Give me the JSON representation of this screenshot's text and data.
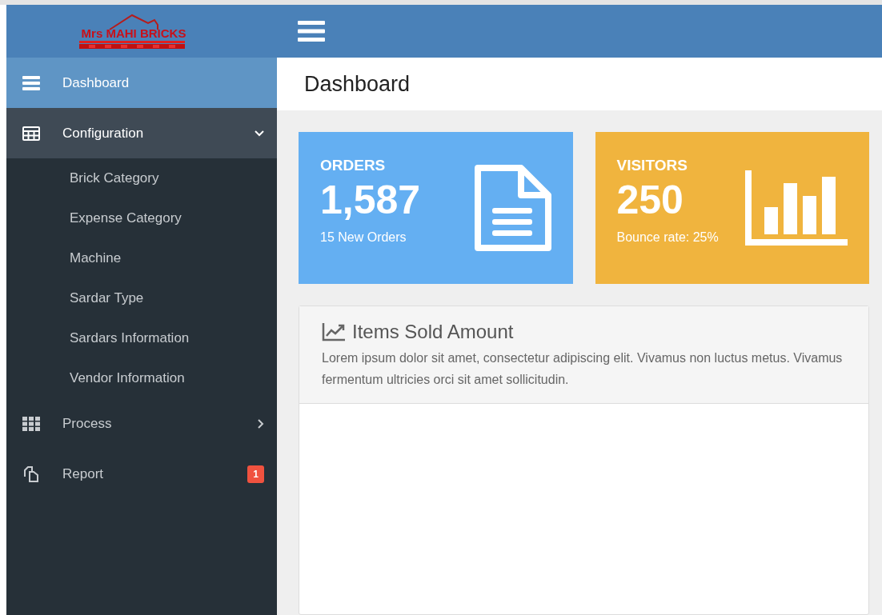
{
  "logo": {
    "text": "Mrs MAHI BRICKS"
  },
  "sidebar": {
    "items": [
      {
        "label": "Dashboard",
        "selected": true
      },
      {
        "label": "Configuration",
        "selected": false,
        "expanded": true,
        "children": [
          {
            "label": "Brick Category"
          },
          {
            "label": "Expense Category"
          },
          {
            "label": "Machine"
          },
          {
            "label": "Sardar Type"
          },
          {
            "label": "Sardars Information"
          },
          {
            "label": "Vendor Information"
          }
        ]
      },
      {
        "label": "Process",
        "selected": false,
        "expanded": false
      },
      {
        "label": "Report",
        "selected": false,
        "badge": "1"
      }
    ]
  },
  "page_title": "Dashboard",
  "stat_cards": [
    {
      "kind": "orders",
      "color": "#64aff2",
      "title": "ORDERS",
      "value": "1,587",
      "note": "15 New Orders"
    },
    {
      "kind": "visitors",
      "color": "#f0b43e",
      "title": "VISITORS",
      "value": "250",
      "note": "Bounce rate: 25%"
    }
  ],
  "panel": {
    "title": "Items Sold Amount",
    "text": "Lorem ipsum dolor sit amet, consectetur adipiscing elit. Vivamus non luctus metus. Vivamus fermentum ultricies orci sit amet sollicitudin."
  }
}
